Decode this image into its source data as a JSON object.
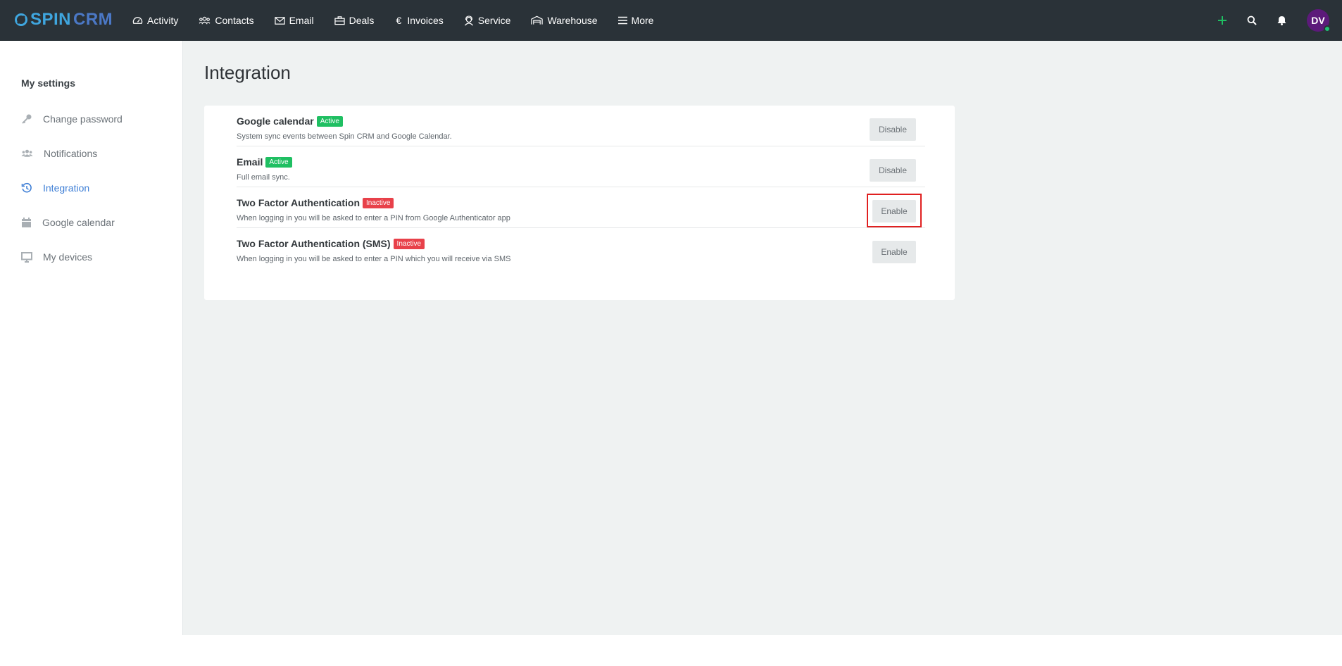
{
  "app": {
    "logo_spin": "SPIN",
    "logo_crm": "CRM",
    "accent_color": "#3f7fd6"
  },
  "nav": [
    {
      "label": "Activity",
      "icon": "gauge-icon"
    },
    {
      "label": "Contacts",
      "icon": "users-icon"
    },
    {
      "label": "Email",
      "icon": "envelope-icon"
    },
    {
      "label": "Deals",
      "icon": "briefcase-icon"
    },
    {
      "label": "Invoices",
      "icon": "euro-icon"
    },
    {
      "label": "Service",
      "icon": "support-icon"
    },
    {
      "label": "Warehouse",
      "icon": "warehouse-icon"
    },
    {
      "label": "More",
      "icon": "menu-icon"
    }
  ],
  "top_actions": {
    "add_icon": "plus-icon",
    "search_icon": "search-icon",
    "notifications_icon": "bell-icon",
    "avatar_initials": "DV",
    "avatar_status_color": "#1fbf75"
  },
  "sidebar": {
    "title": "My settings",
    "items": [
      {
        "label": "Change password",
        "icon": "key-icon",
        "active": false
      },
      {
        "label": "Notifications",
        "icon": "users-icon",
        "active": false
      },
      {
        "label": "Integration",
        "icon": "history-icon",
        "active": true
      },
      {
        "label": "Google calendar",
        "icon": "calendar-icon",
        "active": false
      },
      {
        "label": "My devices",
        "icon": "monitor-icon",
        "active": false
      }
    ]
  },
  "main": {
    "title": "Integration",
    "integrations": [
      {
        "name": "Google calendar",
        "status": "Active",
        "status_color": "#1fbf62",
        "description": "System sync events between Spin CRM and Google Calendar.",
        "button": "Disable"
      },
      {
        "name": "Email",
        "status": "Active",
        "status_color": "#1fbf62",
        "description": "Full email sync.",
        "button": "Disable"
      },
      {
        "name": "Two Factor Authentication",
        "status": "Inactive",
        "status_color": "#e8414a",
        "description": "When logging in you will be asked to enter a PIN from Google Authenticator app",
        "button": "Enable"
      },
      {
        "name": "Two Factor Authentication (SMS)",
        "status": "Inactive",
        "status_color": "#e8414a",
        "description": "When logging in you will be asked to enter a PIN which you will receive via SMS",
        "button": "Enable"
      }
    ]
  }
}
